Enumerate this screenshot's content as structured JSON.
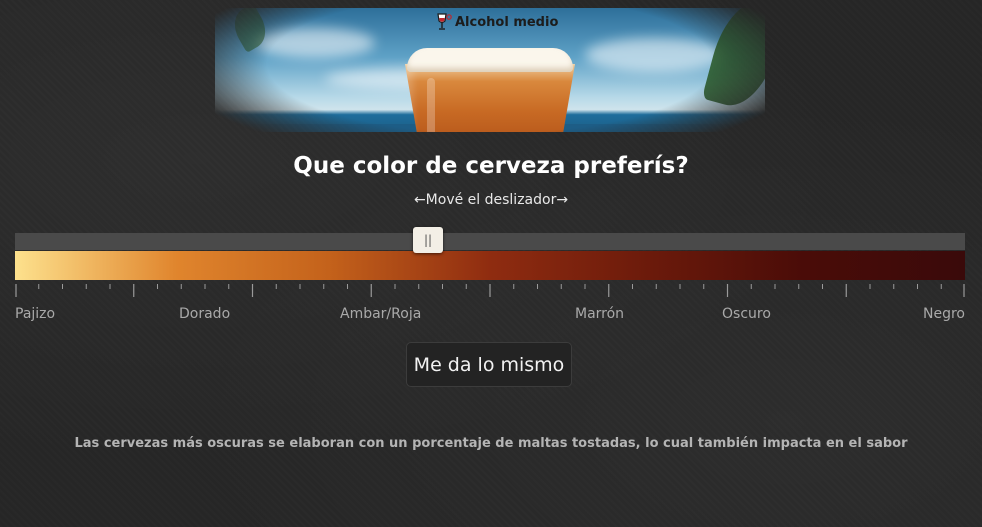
{
  "hero": {
    "badge_label": "Alcohol medio",
    "badge_icon": "wine-glass-icon"
  },
  "question": {
    "title": "Que color de cerveza preferís?",
    "hint": "←Mové el deslizador→"
  },
  "slider": {
    "handle_glyph": "||",
    "value_fraction": 0.435,
    "gradient_stops": [
      "#fde18d",
      "#e0852d",
      "#c4621b",
      "#8f2c10",
      "#6b1a0b",
      "#4a0c08",
      "#3a0a0a"
    ],
    "tick_count": 41,
    "labels": [
      {
        "text": "Pajizo",
        "fraction": 0.0
      },
      {
        "text": "Dorado",
        "fraction": 0.2
      },
      {
        "text": "Ambar/Roja",
        "fraction": 0.385
      },
      {
        "text": "Marrón",
        "fraction": 0.615
      },
      {
        "text": "Oscuro",
        "fraction": 0.77
      },
      {
        "text": "Negro",
        "fraction": 1.0
      }
    ]
  },
  "actions": {
    "indifferent_label": "Me da lo mismo"
  },
  "footnote": "Las cervezas más oscuras se elaboran con un porcentaje de maltas tostadas, lo cual también impacta en el sabor",
  "colors": {
    "background": "#262626",
    "track": "#4a4a4a",
    "label": "#a9a9a9",
    "badge_icon_red": "#c0272d"
  }
}
